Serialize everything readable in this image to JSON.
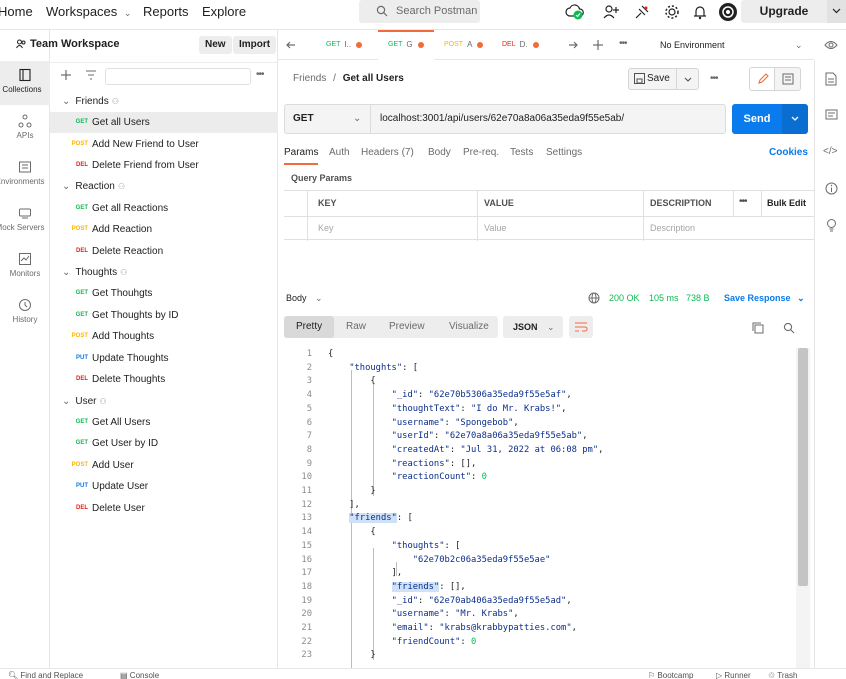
{
  "header": {
    "home": "Home",
    "workspaces": "Workspaces",
    "reports": "Reports",
    "explore": "Explore",
    "search_placeholder": "Search Postman",
    "upgrade": "Upgrade"
  },
  "rail": {
    "collections": "Collections",
    "apis": "APIs",
    "environments": "Environments",
    "mock_servers": "Mock Servers",
    "monitors": "Monitors",
    "history": "History"
  },
  "workspace": {
    "title": "Team Workspace",
    "new_label": "New",
    "import_label": "Import",
    "folders": [
      {
        "name": "Friends",
        "items": [
          {
            "method": "GET",
            "name": "Get all Users"
          },
          {
            "method": "POST",
            "name": "Add New Friend to User"
          },
          {
            "method": "DEL",
            "name": "Delete Friend from User"
          }
        ]
      },
      {
        "name": "Reaction",
        "items": [
          {
            "method": "GET",
            "name": "Get all Reactions"
          },
          {
            "method": "POST",
            "name": "Add Reaction"
          },
          {
            "method": "DEL",
            "name": "Delete Reaction"
          }
        ]
      },
      {
        "name": "Thoughts",
        "items": [
          {
            "method": "GET",
            "name": "Get Thouhgts"
          },
          {
            "method": "GET",
            "name": "Get Thoughts by ID"
          },
          {
            "method": "POST",
            "name": "Add Thoughts"
          },
          {
            "method": "PUT",
            "name": "Update Thoughts"
          },
          {
            "method": "DEL",
            "name": "Delete Thoughts"
          }
        ]
      },
      {
        "name": "User",
        "items": [
          {
            "method": "GET",
            "name": "Get All Users"
          },
          {
            "method": "GET",
            "name": "Get User by ID"
          },
          {
            "method": "POST",
            "name": "Add User"
          },
          {
            "method": "PUT",
            "name": "Update User"
          },
          {
            "method": "DEL",
            "name": "Delete User"
          }
        ]
      }
    ]
  },
  "tabs": [
    {
      "method": "GET",
      "label": "I.."
    },
    {
      "method": "GET",
      "label": "G"
    },
    {
      "method": "POST",
      "label": "A"
    },
    {
      "method": "DEL",
      "label": "D."
    }
  ],
  "environment": "No Environment",
  "request": {
    "breadcrumb_parent": "Friends",
    "breadcrumb_sep": "/",
    "breadcrumb_current": "Get all Users",
    "save_label": "Save",
    "method": "GET",
    "url": "localhost:3001/api/users/62e70a8a06a35eda9f55e5ab/",
    "send_label": "Send",
    "tabs": [
      "Params",
      "Auth",
      "Headers (7)",
      "Body",
      "Pre-req.",
      "Tests",
      "Settings"
    ],
    "cookies_label": "Cookies",
    "query_params_title": "Query Params",
    "columns": {
      "key": "KEY",
      "value": "VALUE",
      "description": "DESCRIPTION",
      "bulk_edit": "Bulk Edit"
    },
    "placeholders": {
      "key": "Key",
      "value": "Value",
      "description": "Description"
    }
  },
  "response": {
    "body_label": "Body",
    "status": "200 OK",
    "time": "105 ms",
    "size": "738 B",
    "save_response": "Save Response",
    "view_tabs": [
      "Pretty",
      "Raw",
      "Preview",
      "Visualize"
    ],
    "format": "JSON",
    "lines": [
      "{",
      "    \"thoughts\": [",
      "        {",
      "            \"_id\": \"62e70b5306a35eda9f55e5af\",",
      "            \"thoughtText\": \"I do Mr. Krabs!\",",
      "            \"username\": \"Spongebob\",",
      "            \"userId\": \"62e70a8a06a35eda9f55e5ab\",",
      "            \"createdAt\": \"Jul 31, 2022 at 06:08 pm\",",
      "            \"reactions\": [],",
      "            \"reactionCount\": 0",
      "        }",
      "    ],",
      "    \"friends\": [",
      "        {",
      "            \"thoughts\": [",
      "                \"62e70b2c06a35eda9f55e5ae\"",
      "            ],",
      "            \"friends\": [],",
      "            \"_id\": \"62e70ab406a35eda9f55e5ad\",",
      "            \"username\": \"Mr. Krabs\",",
      "            \"email\": \"krabs@krabbypatties.com\",",
      "            \"friendCount\": 0",
      "        }"
    ]
  },
  "footer": {
    "find_replace": "Find and Replace",
    "console": "Console",
    "bootcamp": "Bootcamp",
    "runner": "Runner",
    "trash": "Trash"
  },
  "colors": {
    "accent": "#f26b3a",
    "send": "#097bed",
    "get": "#0cbb52",
    "post": "#ffb400",
    "put": "#097bed",
    "del": "#eb2013"
  }
}
